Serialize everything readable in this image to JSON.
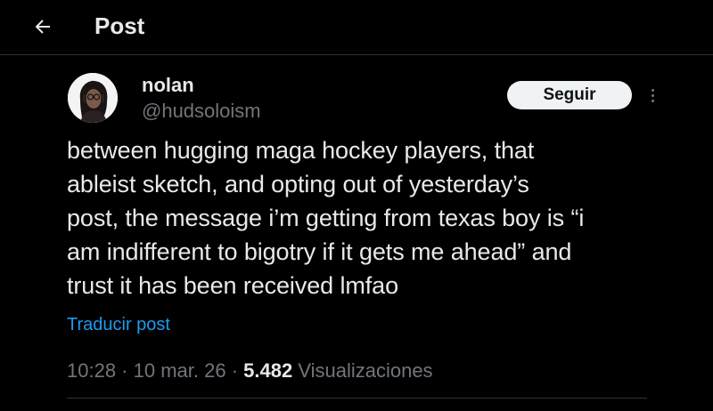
{
  "header": {
    "back_icon": "arrow-left-icon",
    "title": "Post"
  },
  "author": {
    "display_name": "nolan",
    "handle": "@hudsoloism",
    "avatar_icon": "profile-avatar"
  },
  "actions": {
    "follow_label": "Seguir",
    "more_icon": "more-vertical-icon"
  },
  "post": {
    "text": "between hugging maga hockey players, that\nableist sketch, and opting out of yesterday’s\npost, the message i’m getting from texas boy is “i\nam indifferent to bigotry if it gets me ahead” and\ntrust it has been received lmfao",
    "translate_label": "Traducir post",
    "time": "10:28",
    "sep1": " · ",
    "date": "10 mar. 26",
    "sep2": " · ",
    "views_count": "5.482",
    "views_label": " Visualizaciones"
  },
  "colors": {
    "background": "#000000",
    "text_primary": "#e7e9ea",
    "text_secondary": "#71767b",
    "link": "#1d9bf0",
    "follow_bg": "#eff3f4",
    "divider": "#2f3336"
  }
}
